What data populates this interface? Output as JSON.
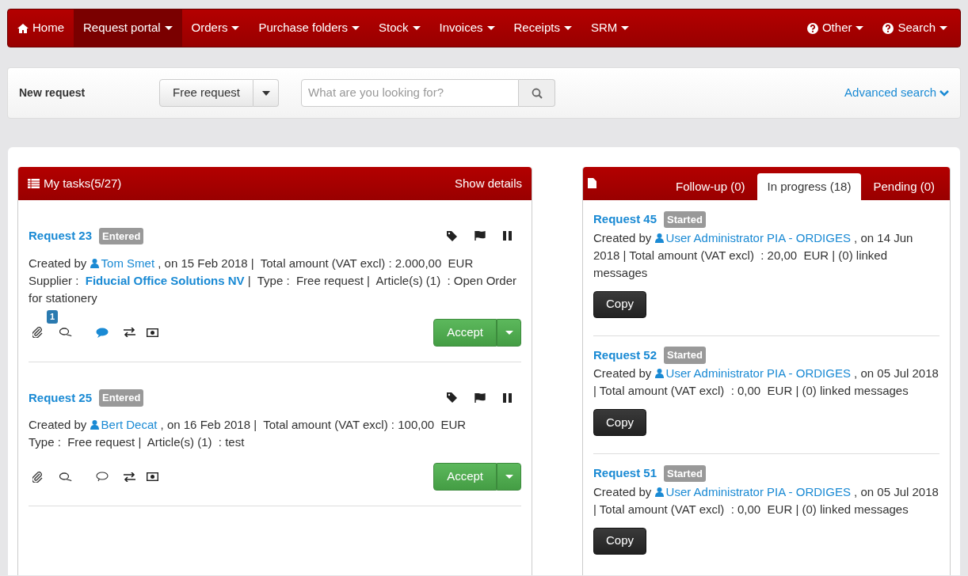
{
  "navbar": {
    "items": [
      {
        "label": "Home",
        "kind": "home",
        "selected": false,
        "dropdown": false
      },
      {
        "label": "Request portal",
        "kind": "menu",
        "selected": true,
        "dropdown": true
      },
      {
        "label": "Orders",
        "kind": "menu",
        "selected": false,
        "dropdown": true
      },
      {
        "label": "Purchase folders",
        "kind": "menu",
        "selected": false,
        "dropdown": true
      },
      {
        "label": "Stock",
        "kind": "menu",
        "selected": false,
        "dropdown": true
      },
      {
        "label": "Invoices",
        "kind": "menu",
        "selected": false,
        "dropdown": true
      },
      {
        "label": "Receipts",
        "kind": "menu",
        "selected": false,
        "dropdown": true
      },
      {
        "label": "SRM",
        "kind": "menu",
        "selected": false,
        "dropdown": true
      }
    ],
    "right_items": [
      {
        "label": "Other",
        "kind": "help",
        "selected": false,
        "dropdown": true
      },
      {
        "label": "Search",
        "kind": "help",
        "selected": false,
        "dropdown": true
      }
    ]
  },
  "toolbar": {
    "title": "New request",
    "request_type": "Free request",
    "search": {
      "placeholder": "What are you looking for?"
    },
    "advanced_search": "Advanced search"
  },
  "tasks": {
    "title": "My tasks(5/27)",
    "show_details": "Show details",
    "items": [
      {
        "title": "Request 23",
        "status": "Entered",
        "paragraphs": [
          [
            {
              "kind": "text",
              "text": "Created by "
            },
            {
              "kind": "user",
              "text": "Tom Smet"
            },
            {
              "kind": "text",
              "text": " , on 15 Feb 2018 |  Total amount (VAT excl) : 2.000,00  EUR"
            }
          ],
          [
            {
              "kind": "text",
              "text": "Supplier :  "
            },
            {
              "kind": "supplier",
              "text": "Fiducial Office Solutions NV"
            },
            {
              "kind": "text",
              "text": " |  Type :  Free request |  Article(s) (1)  : Open Order for stationery"
            }
          ]
        ],
        "badge": "1",
        "has_comments": true,
        "action": "Accept"
      },
      {
        "title": "Request 25",
        "status": "Entered",
        "paragraphs": [
          [
            {
              "kind": "text",
              "text": "Created by "
            },
            {
              "kind": "user",
              "text": "Bert Decat"
            },
            {
              "kind": "text",
              "text": " , on 16 Feb 2018 |  Total amount (VAT excl) : 100,00  EUR"
            }
          ],
          [
            {
              "kind": "text",
              "text": "Type :  Free request |  Article(s) (1)  : test"
            }
          ]
        ],
        "has_comments": false,
        "action": "Accept"
      }
    ]
  },
  "requests": {
    "tabs": [
      {
        "label": "Follow-up (0)",
        "selected": false
      },
      {
        "label": "In progress (18)",
        "selected": true
      },
      {
        "label": "Pending (0)",
        "selected": false
      }
    ],
    "items": [
      {
        "title": "Request 45",
        "status": "Started",
        "paragraphs": [
          [
            {
              "kind": "text",
              "text": "Created by "
            },
            {
              "kind": "user",
              "text": "User Administrator PIA - ORDIGES"
            },
            {
              "kind": "text",
              "text": " , on 14 Jun 2018 | Total amount (VAT excl)  : 20,00  EUR | (0) linked messages"
            }
          ]
        ],
        "action": "Copy"
      },
      {
        "title": "Request 52",
        "status": "Started",
        "paragraphs": [
          [
            {
              "kind": "text",
              "text": "Created by "
            },
            {
              "kind": "user",
              "text": "User Administrator PIA - ORDIGES"
            },
            {
              "kind": "text",
              "text": " , on 05 Jul 2018 | Total amount (VAT excl)  : 0,00  EUR | (0) linked messages"
            }
          ]
        ],
        "action": "Copy"
      },
      {
        "title": "Request 51",
        "status": "Started",
        "paragraphs": [
          [
            {
              "kind": "text",
              "text": "Created by "
            },
            {
              "kind": "user",
              "text": "User Administrator PIA - ORDIGES"
            },
            {
              "kind": "text",
              "text": " , on 05 Jul 2018 | Total amount (VAT excl)  : 0,00  EUR | (0) linked messages"
            }
          ]
        ],
        "action": "Copy"
      }
    ]
  }
}
